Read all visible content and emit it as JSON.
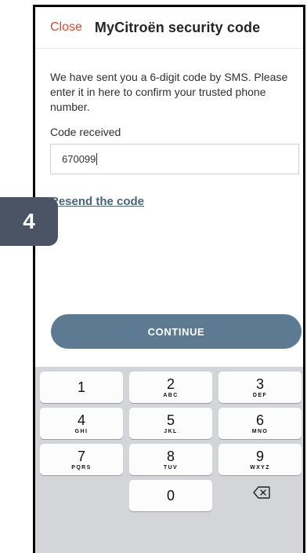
{
  "header": {
    "close_label": "Close",
    "title": "MyCitroën security code"
  },
  "message": "We have sent you a 6-digit code by SMS. Please enter it in here to confirm your trusted phone number.",
  "code_field": {
    "label": "Code received",
    "value": "670099"
  },
  "resend_label": "Resend the code",
  "continue_label": "CONTINUE",
  "step_badge": "4",
  "keypad": {
    "keys": [
      {
        "digit": "1",
        "letters": ""
      },
      {
        "digit": "2",
        "letters": "ABC"
      },
      {
        "digit": "3",
        "letters": "DEF"
      },
      {
        "digit": "4",
        "letters": "GHI"
      },
      {
        "digit": "5",
        "letters": "JKL"
      },
      {
        "digit": "6",
        "letters": "MNO"
      },
      {
        "digit": "7",
        "letters": "PQRS"
      },
      {
        "digit": "8",
        "letters": "TUV"
      },
      {
        "digit": "9",
        "letters": "WXYZ"
      },
      {
        "digit": "0",
        "letters": ""
      }
    ],
    "backspace_icon": "backspace-icon"
  },
  "colors": {
    "accent_close": "#d8492f",
    "button": "#5c7a92",
    "link": "#4a6478",
    "badge": "#4a5465",
    "keypad_bg": "#d3d5d8"
  }
}
